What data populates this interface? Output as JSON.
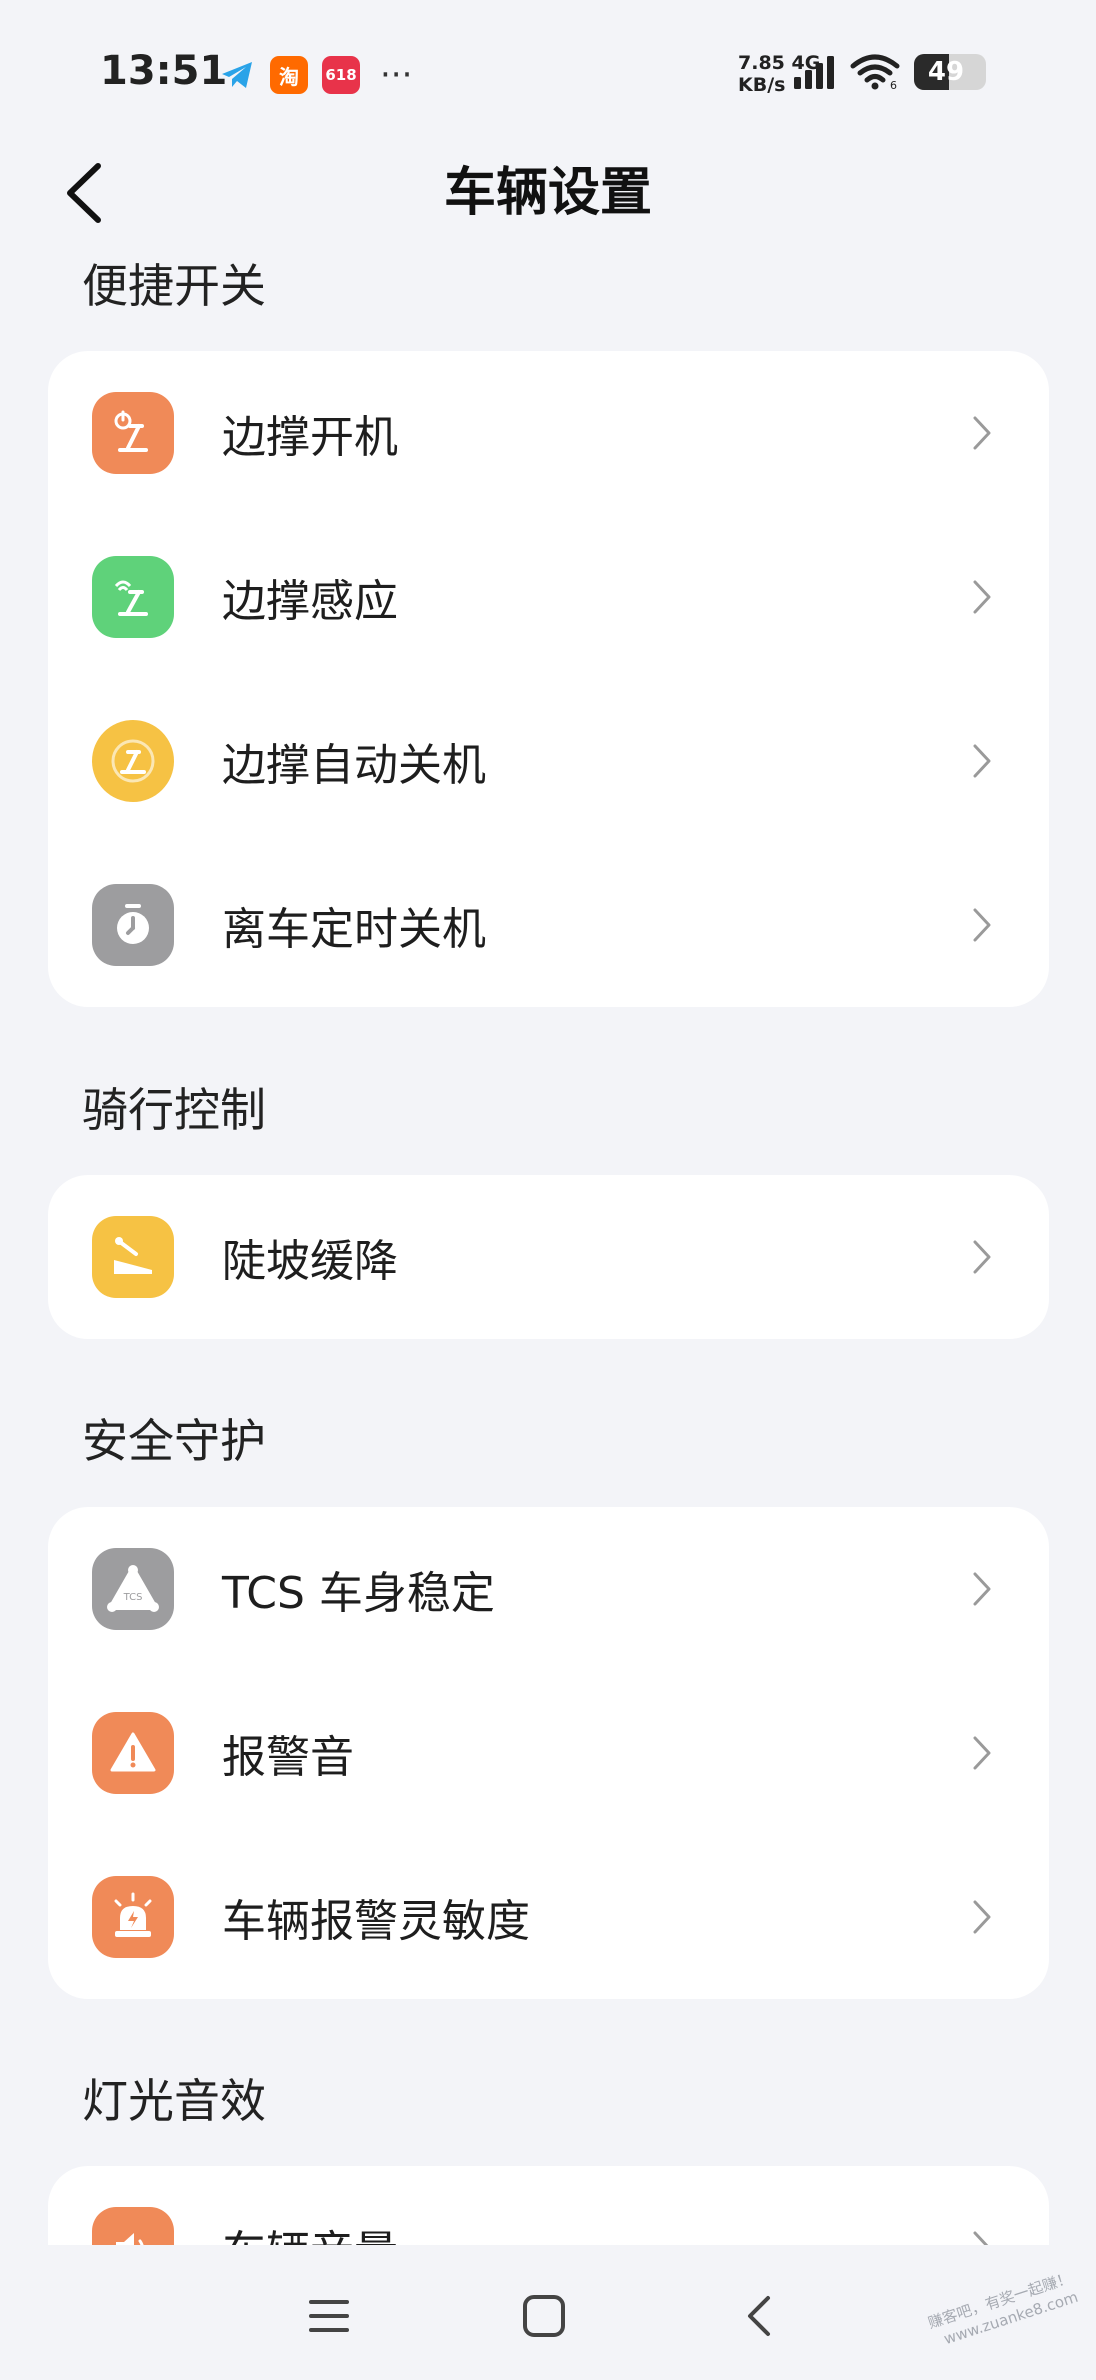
{
  "status_bar": {
    "time": "13:51",
    "net_speed_value": "7.85",
    "net_speed_unit": "KB/s",
    "network_type": "4G",
    "battery_level": "49",
    "notification_apps": [
      "telegram-icon",
      "taobao-icon",
      "618-app-icon"
    ],
    "taobao_label": "淘",
    "app618_label": "618"
  },
  "header": {
    "title": "车辆设置",
    "back_icon": "chevron-left-icon"
  },
  "sections": [
    {
      "title": "便捷开关",
      "items": [
        {
          "label": "边撑开机",
          "icon": "kickstand-power-icon",
          "color": "#f08a58"
        },
        {
          "label": "边撑感应",
          "icon": "kickstand-sensor-icon",
          "color": "#5fd27a"
        },
        {
          "label": "边撑自动关机",
          "icon": "kickstand-auto-off-icon",
          "color": "#f6c244"
        },
        {
          "label": "离车定时关机",
          "icon": "timer-icon",
          "color": "#9d9d9f"
        }
      ]
    },
    {
      "title": "骑行控制",
      "items": [
        {
          "label": "陡坡缓降",
          "icon": "hill-descent-icon",
          "color": "#f6c244"
        }
      ]
    },
    {
      "title": "安全守护",
      "items": [
        {
          "label": "TCS 车身稳定",
          "icon": "tcs-icon",
          "color": "#9d9d9f",
          "icon_text": "TCS"
        },
        {
          "label": "报警音",
          "icon": "warning-icon",
          "color": "#f08a58"
        },
        {
          "label": "车辆报警灵敏度",
          "icon": "alarm-siren-icon",
          "color": "#f08a58"
        }
      ]
    },
    {
      "title": "灯光音效",
      "items": [
        {
          "label": "车辆音量",
          "icon": "speaker-icon",
          "color": "#f08a58"
        }
      ]
    }
  ],
  "nav_bar": {
    "menu_icon": "menu-icon",
    "home_icon": "home-square-icon",
    "back_icon": "back-triangle-icon"
  },
  "watermark": {
    "line1": "赚客吧，有奖一起赚！",
    "line2": "www.zuanke8.com"
  }
}
